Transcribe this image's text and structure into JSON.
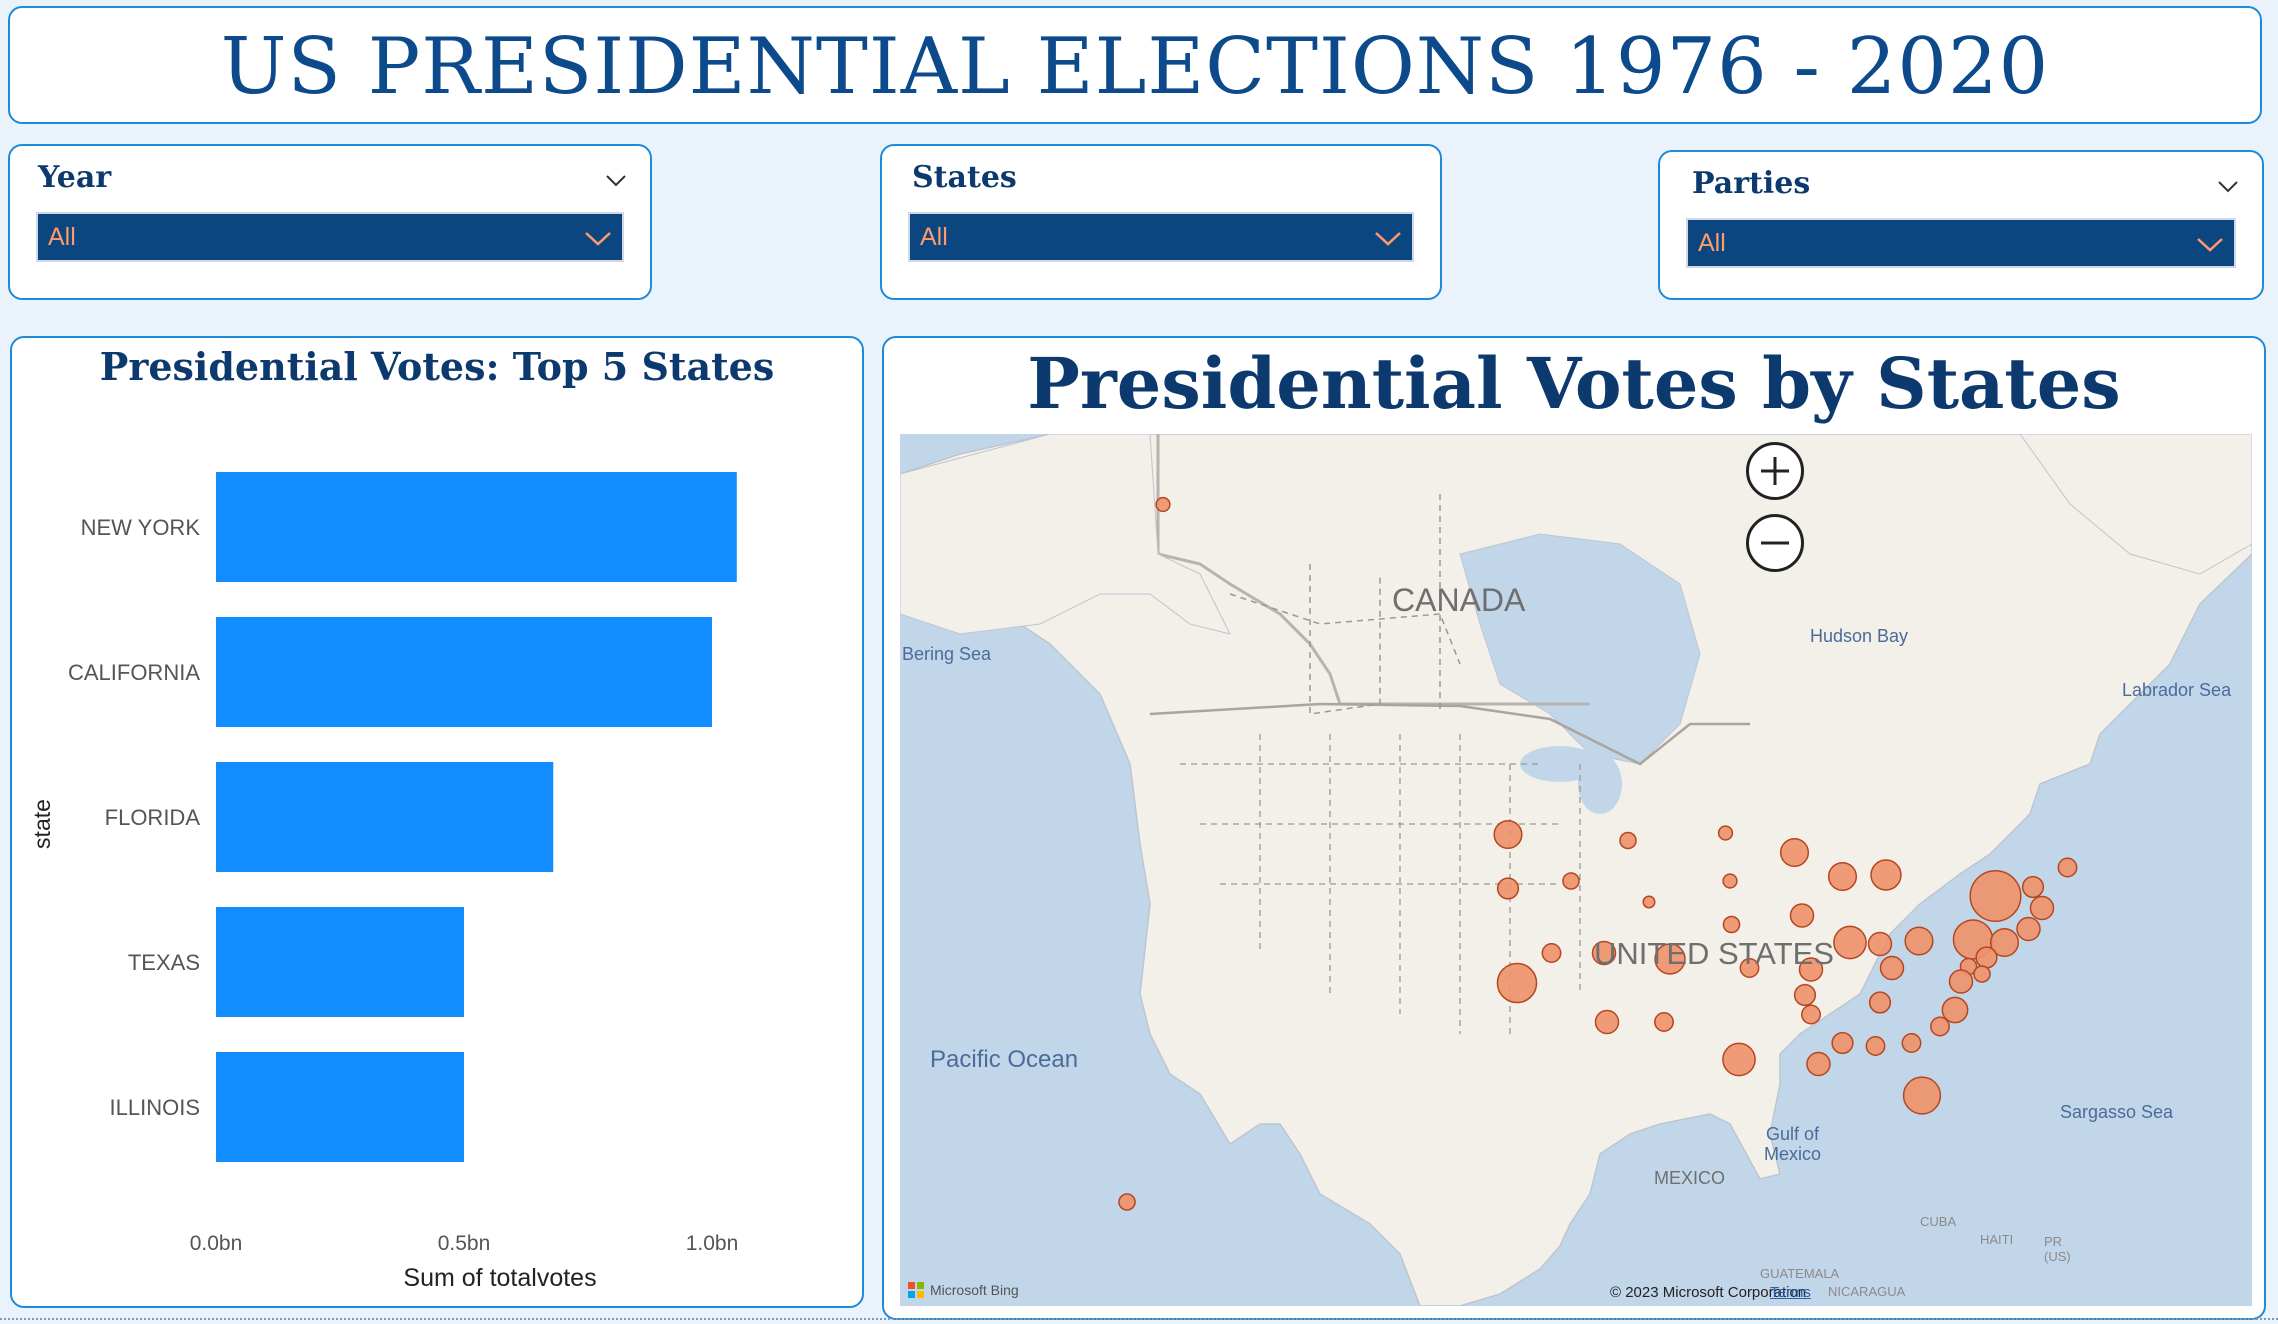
{
  "header": {
    "title": "US PRESIDENTIAL ELECTIONS 1976 - 2020"
  },
  "filters": {
    "year": {
      "label": "Year",
      "value": "All"
    },
    "states": {
      "label": "States",
      "value": "All"
    },
    "parties": {
      "label": "Parties",
      "value": "All"
    }
  },
  "bar_panel": {
    "title": "Presidential Votes: Top 5 States"
  },
  "chart_data": {
    "type": "bar",
    "orientation": "horizontal",
    "title": "Presidential Votes: Top 5 States",
    "xlabel": "Sum of totalvotes",
    "ylabel": "state",
    "categories": [
      "NEW YORK",
      "CALIFORNIA",
      "FLORIDA",
      "TEXAS",
      "ILLINOIS"
    ],
    "values": [
      1.05,
      1.0,
      0.68,
      0.5,
      0.5
    ],
    "xlim": [
      0,
      1.1
    ],
    "xticks": [
      "0.0bn",
      "0.5bn",
      "1.0bn"
    ],
    "color": "#118dff"
  },
  "map_panel": {
    "title": "Presidential Votes by States",
    "labels": {
      "canada": "CANADA",
      "united_states": "UNITED STATES",
      "mexico": "MEXICO",
      "bering_sea": "Bering Sea",
      "hudson_bay": "Hudson Bay",
      "labrador_sea": "Labrador Sea",
      "pacific_ocean": "Pacific Ocean",
      "gulf_of_mexico": "Gulf of\nMexico",
      "sargasso_sea": "Sargasso Sea",
      "cuba": "CUBA",
      "haiti": "HAITI",
      "pr": "PR\n(US)",
      "guatemala": "GUATEMALA",
      "nicaragua": "NICARAGUA"
    },
    "brand": "Microsoft Bing",
    "copyright": "© 2023 Microsoft Corporation",
    "terms": "Terms",
    "zoom_in_icon": "plus-icon",
    "zoom_out_icon": "minus-icon",
    "bubble_color": "#f0916a"
  }
}
